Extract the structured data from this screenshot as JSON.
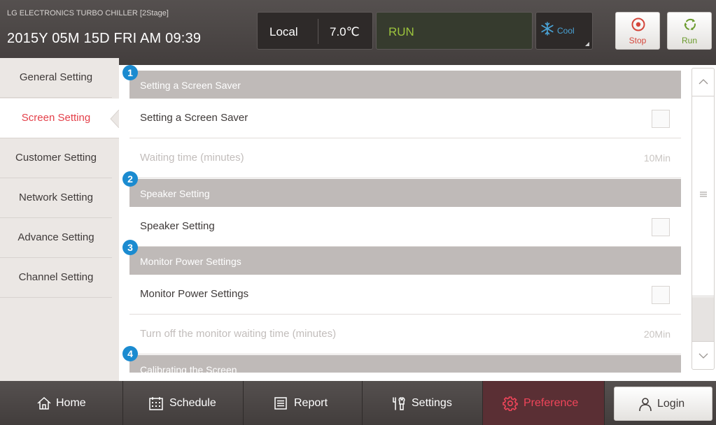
{
  "header": {
    "device_name": "LG ELECTRONICS TURBO CHILLER [2Stage]",
    "datetime": "2015Y 05M 15D  FRI AM 09:39",
    "control_mode": "Local",
    "temperature": "7.0℃",
    "run_status": "RUN",
    "operation_mode": "Cool",
    "stop_label": "Stop",
    "run_label": "Run"
  },
  "sidebar": {
    "items": [
      {
        "label": "General Setting"
      },
      {
        "label": "Screen Setting"
      },
      {
        "label": "Customer Setting"
      },
      {
        "label": "Network Setting"
      },
      {
        "label": "Advance Setting"
      },
      {
        "label": "Channel Setting"
      }
    ],
    "active_index": 1
  },
  "content": {
    "sections": [
      {
        "badge": "1",
        "title": "Setting a Screen Saver",
        "rows": [
          {
            "label": "Setting a Screen Saver",
            "type": "checkbox",
            "checked": false
          },
          {
            "label": "Waiting time (minutes)",
            "type": "value",
            "value": "10Min",
            "disabled": true
          }
        ]
      },
      {
        "badge": "2",
        "title": "Speaker Setting",
        "rows": [
          {
            "label": "Speaker Setting",
            "type": "checkbox",
            "checked": false
          }
        ]
      },
      {
        "badge": "3",
        "title": "Monitor Power Settings",
        "rows": [
          {
            "label": "Monitor Power Settings",
            "type": "checkbox",
            "checked": false
          },
          {
            "label": "Turn off the monitor waiting time (minutes)",
            "type": "value",
            "value": "20Min",
            "disabled": true
          }
        ]
      },
      {
        "badge": "4",
        "title": "Calibrating the Screen",
        "rows": []
      }
    ]
  },
  "bottom_nav": {
    "items": [
      {
        "label": "Home",
        "icon": "home-icon"
      },
      {
        "label": "Schedule",
        "icon": "calendar-icon"
      },
      {
        "label": "Report",
        "icon": "report-icon"
      },
      {
        "label": "Settings",
        "icon": "tools-icon"
      },
      {
        "label": "Preference",
        "icon": "gear-icon"
      }
    ],
    "active_index": 4,
    "login_label": "Login"
  },
  "colors": {
    "accent_red": "#e4404a",
    "run_green": "#9cc43d",
    "cool_blue": "#4aa3d6",
    "badge_blue": "#1b8bd0"
  }
}
